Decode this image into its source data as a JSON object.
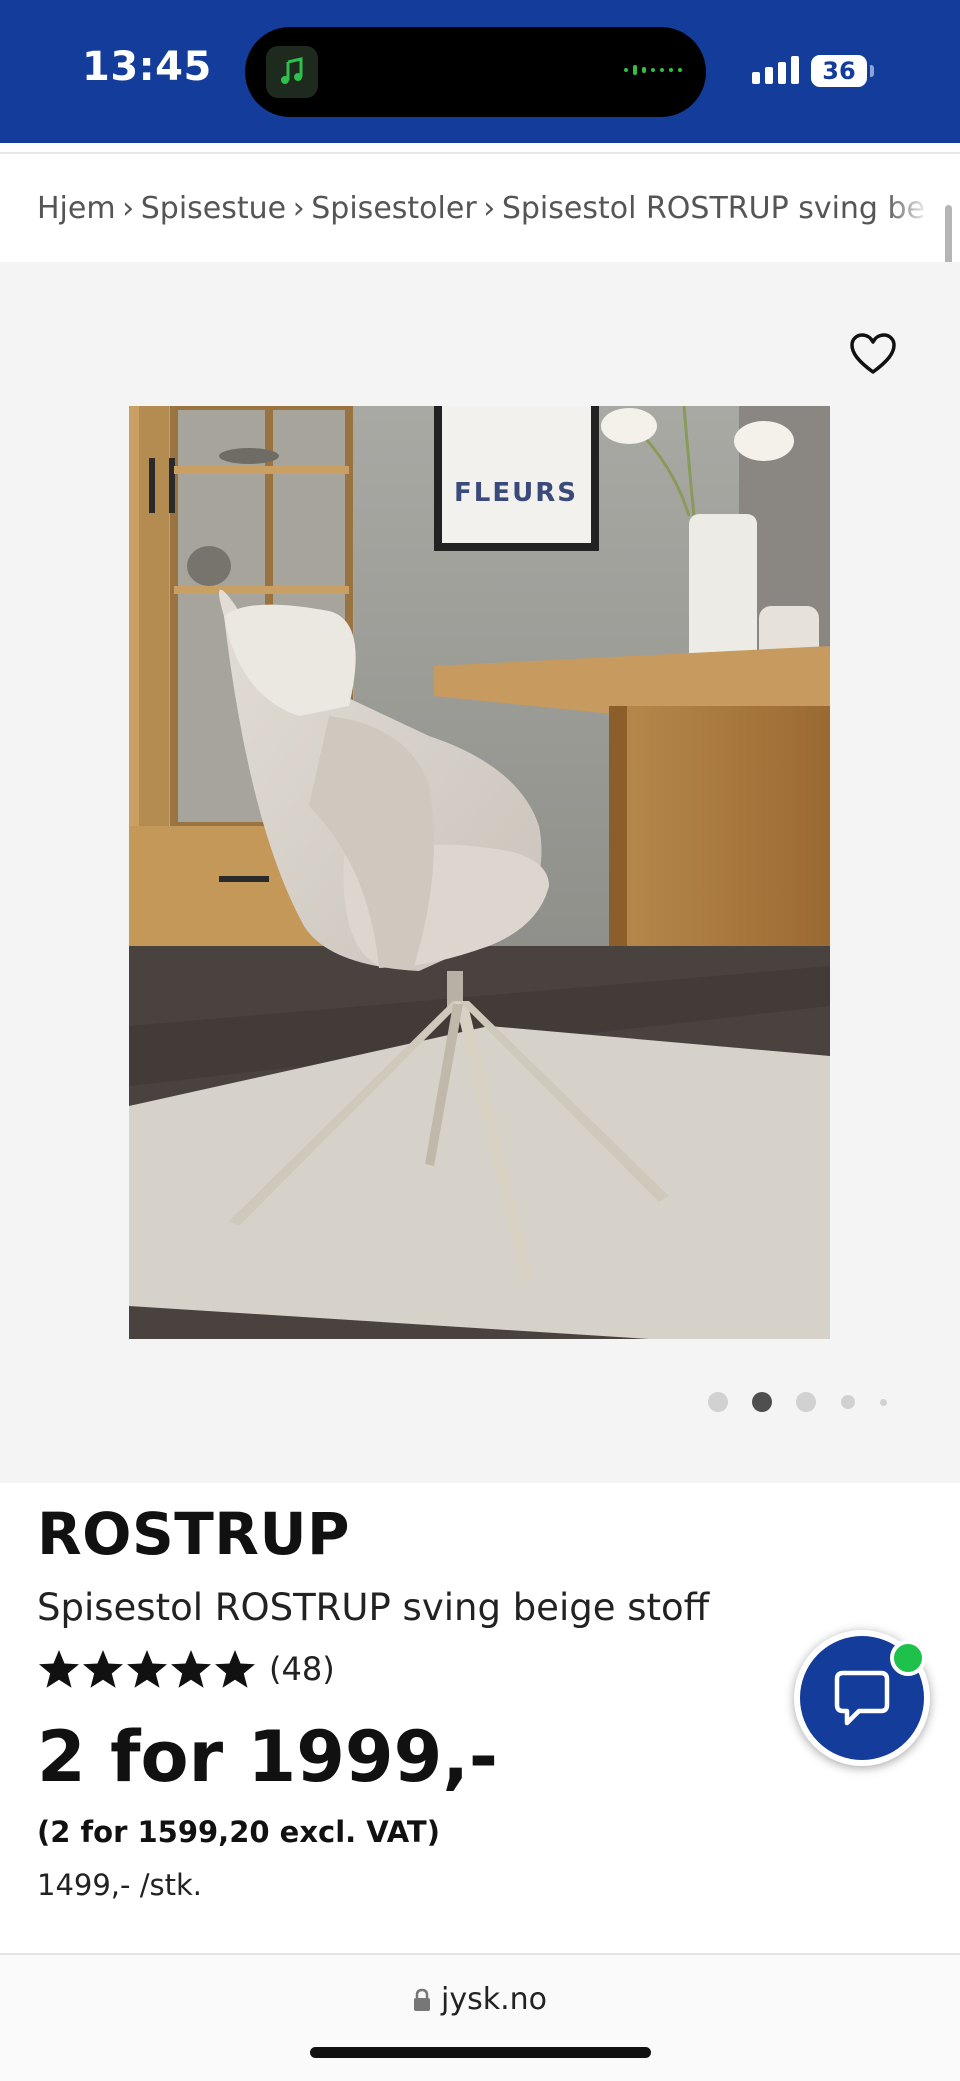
{
  "status_bar": {
    "time": "13:45",
    "battery": "36",
    "background": "#143c9a"
  },
  "breadcrumb": {
    "items": [
      "Hjem",
      "Spisestue",
      "Spisestoler",
      "Spisestol ROSTRUP sving be"
    ],
    "separator": "›"
  },
  "gallery": {
    "image_alt": "Chair photo",
    "art_print_text": "FLEURS",
    "active_dot": 2,
    "dot_count": 5
  },
  "product": {
    "brand": "ROSTRUP",
    "name": "Spisestol ROSTRUP sving beige stoff",
    "rating_stars": 5,
    "rating_count": "(48)",
    "price": "2 for 1999,-",
    "price_excl_vat": "(2 for 1599,20 excl. VAT)",
    "unit_price": "1499,- /stk."
  },
  "browser": {
    "url": "jysk.no"
  },
  "colors": {
    "brand_blue": "#143c9a",
    "online_green": "#1ec24a"
  }
}
